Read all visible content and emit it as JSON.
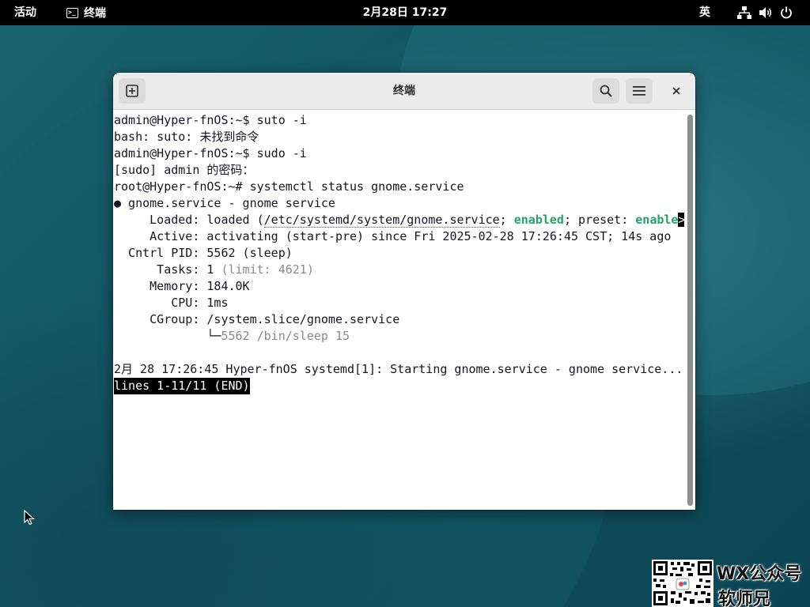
{
  "topbar": {
    "activities": "活动",
    "app_name": "终端",
    "app_icon_glyph": ">_",
    "clock": "2月28日 17:27",
    "input_method": "英",
    "status_icons": [
      "network-icon",
      "volume-icon",
      "power-icon"
    ]
  },
  "window": {
    "title": "终端",
    "buttons": [
      "new-tab-icon",
      "search-icon",
      "menu-icon",
      "close-icon"
    ]
  },
  "terminal": {
    "lines": [
      "admin@Hyper-fnOS:~$ suto -i",
      "bash: suto: 未找到命令",
      "admin@Hyper-fnOS:~$ sudo -i",
      "[sudo] admin 的密码：",
      "root@Hyper-fnOS:~# systemctl status gnome.service",
      "● gnome.service - gnome service"
    ],
    "loaded": {
      "label": "     Loaded: loaded (",
      "path": "/etc/systemd/system/gnome.service",
      "sep1": "; ",
      "state": "enabled",
      "sep2": "; preset: ",
      "preset": "enable",
      "overflow_marker": ">"
    },
    "active_line": "     Active: activating (start-pre) since Fri 2025-02-28 17:26:45 CST; 14s ago",
    "pid_line": "  Cntrl PID: 5562 (sleep)",
    "tasks": {
      "label": "      Tasks: 1 ",
      "limit": "(limit: 4621)"
    },
    "memory_line": "     Memory: 184.0K",
    "cpu_line": "        CPU: 1ms",
    "cgroup_line": "     CGroup: /system.slice/gnome.service",
    "cgroup_tree_prefix": "             └─",
    "cgroup_tree": "5562 /bin/sleep 15",
    "log_line": "2月 28 17:26:45 Hyper-fnOS systemd[1]: Starting gnome.service - gnome service...",
    "pager_status": "lines 1-11/11 (END)"
  },
  "watermark": {
    "line1": "WX公众号",
    "line2": "软师兄"
  },
  "colors": {
    "enabled_green": "#26a269",
    "topbar_bg": "#000000",
    "headerbar_bg": "#ebebeb"
  }
}
